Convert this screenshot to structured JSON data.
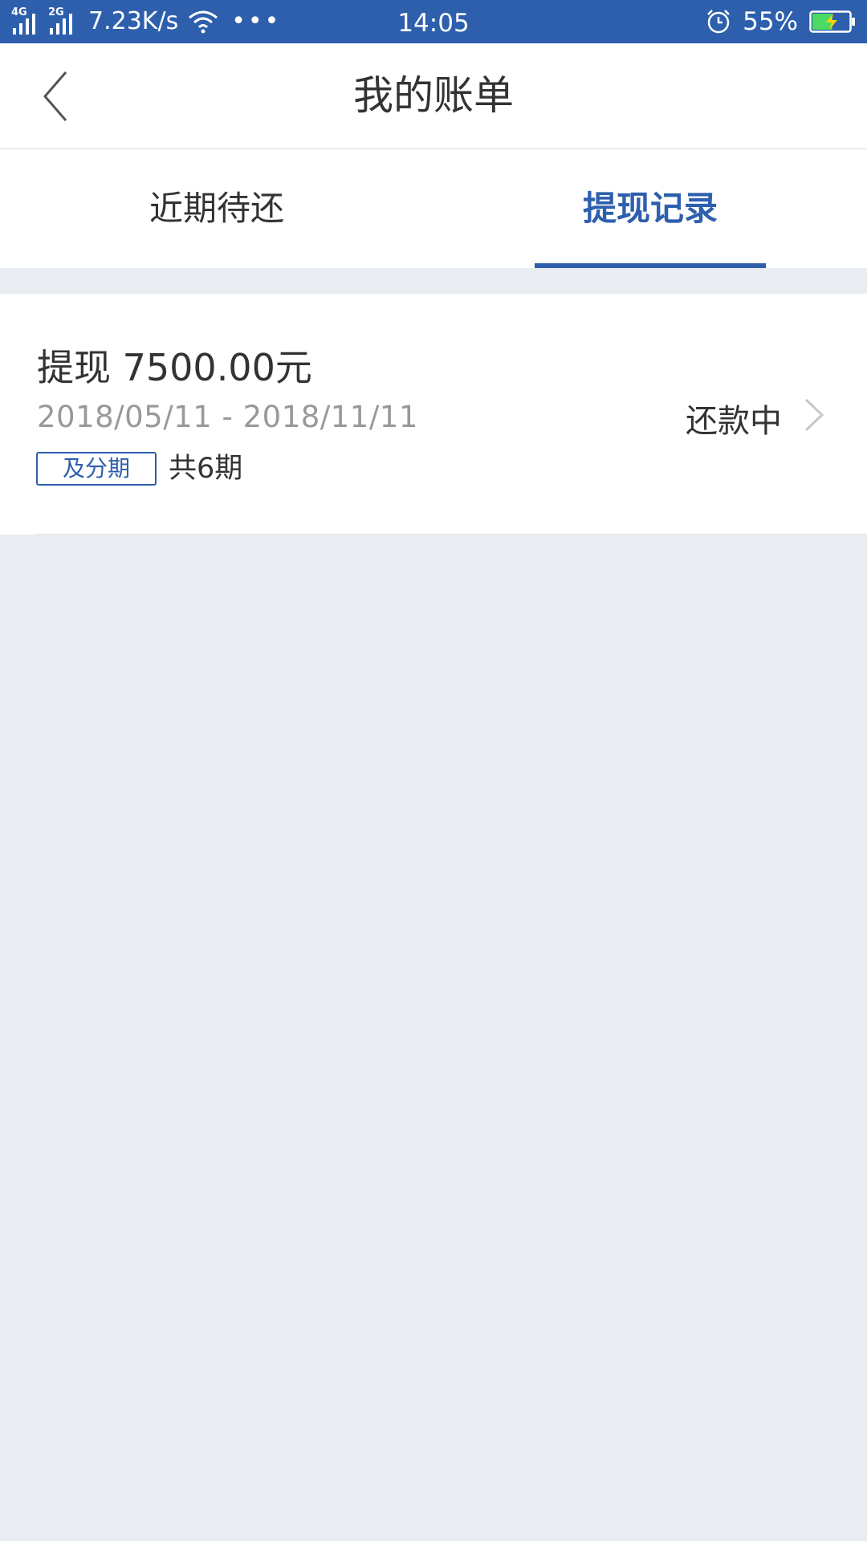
{
  "status_bar": {
    "network1": "4G",
    "network2": "2G",
    "speed": "7.23K/s",
    "dots": "•••",
    "time": "14:05",
    "battery_percent": "55%",
    "battery_level": 0.55,
    "battery_color": "#4cd964",
    "charging_color": "#ffd400"
  },
  "nav": {
    "title": "我的账单",
    "back_icon": "chevron-left-icon"
  },
  "tabs": [
    {
      "label": "近期待还",
      "active": false
    },
    {
      "label": "提现记录",
      "active": true
    }
  ],
  "record": {
    "title": "提现 7500.00元",
    "dates": "2018/05/11 - 2018/11/11",
    "tag": "及分期",
    "count": "共6期",
    "status": "还款中",
    "chevron_icon": "chevron-right-icon"
  },
  "colors": {
    "brand": "#2d5fad",
    "background": "#e9edf1",
    "secondary_text": "#999999"
  }
}
